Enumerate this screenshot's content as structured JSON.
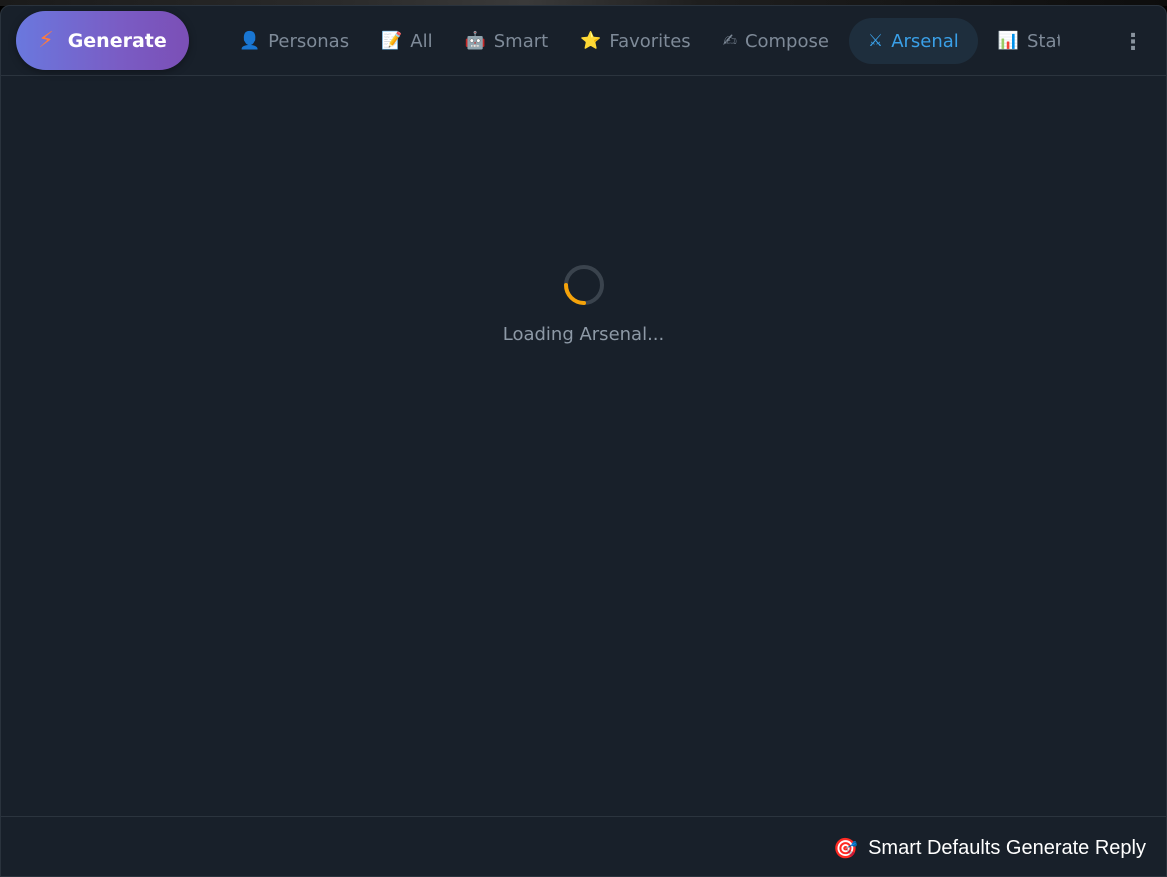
{
  "generate": {
    "label": "Generate",
    "icon": "bolt-icon"
  },
  "tabs": [
    {
      "label": "Personas",
      "icon": "👤"
    },
    {
      "label": "All",
      "icon": "📝"
    },
    {
      "label": "Smart",
      "icon": "🤖"
    },
    {
      "label": "Favorites",
      "icon": "⭐"
    },
    {
      "label": "Compose",
      "icon": "✍"
    },
    {
      "label": "Arsenal",
      "icon": "⚔"
    },
    {
      "label": "Stat",
      "icon": "📊"
    }
  ],
  "active_tab": "Arsenal",
  "more_icon": "⋮",
  "loading": {
    "text": "Loading Arsenal..."
  },
  "footer": {
    "icon": "🎯",
    "label": "Smart Defaults Generate Reply"
  },
  "colors": {
    "background": "#18202a",
    "accent": "#3aa0e8",
    "spinner": "#f5a30a",
    "generate_gradient_start": "#6a78de",
    "generate_gradient_end": "#7b4fb6"
  }
}
